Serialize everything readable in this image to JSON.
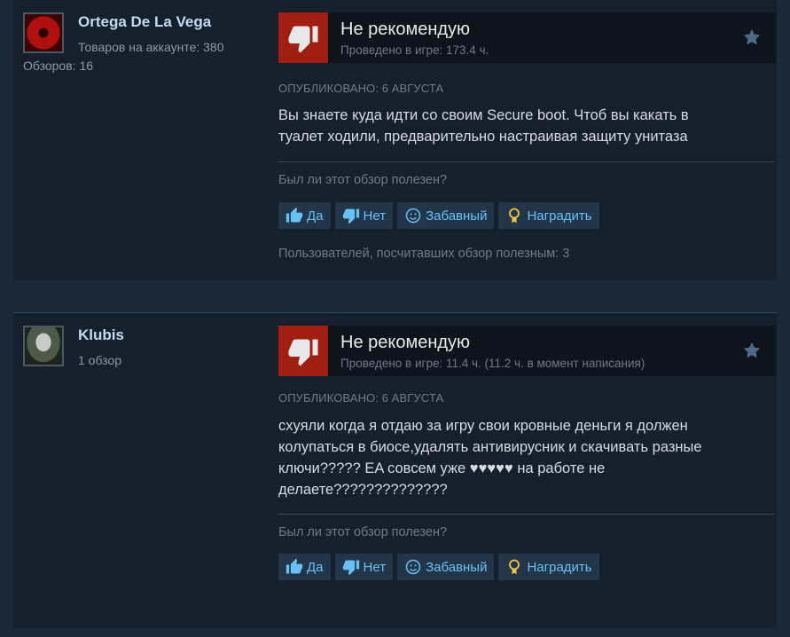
{
  "colors": {
    "background": "#1b2838",
    "card": "#16202d",
    "not_recommended": "#a01e12",
    "link": "#67c1f5",
    "username": "#c1dbf4"
  },
  "reviews": [
    {
      "user": {
        "name": "Ortega De La Vega",
        "products": "Товаров на аккаунте: 380",
        "reviews": "Обзоров: 16"
      },
      "verdict": "Не рекомендую",
      "playtime": "Проведено в игре: 173.4 ч.",
      "posted": "ОПУБЛИКОВАНО: 6 АВГУСТА",
      "text_lines": [
        "Вы знаете куда идти со своим Secure boot. Чтоб вы какать в",
        "туалет ходили, предварительно настраивая защиту унитаза"
      ],
      "helpful_question": "Был ли этот обзор полезен?",
      "buttons": {
        "yes": "Да",
        "no": "Нет",
        "funny": "Забавный",
        "award": "Наградить"
      },
      "helpful_count": "Пользователей, посчитавших обзор полезным: 3"
    },
    {
      "user": {
        "name": "Klubis",
        "reviews": "1 обзор"
      },
      "verdict": "Не рекомендую",
      "playtime": "Проведено в игре: 11.4 ч. (11.2 ч. в момент написания)",
      "posted": "ОПУБЛИКОВАНО: 6 АВГУСТА",
      "text_lines": [
        "схуяли когда я отдаю за игру свои кровные деньги я должен",
        "колупаться в биосе,удалять антивирусник и скачивать разные",
        "ключи????? EA совсем уже ♥♥♥♥♥ на работе не",
        "делаете??????????????"
      ],
      "helpful_question": "Был ли этот обзор полезен?",
      "buttons": {
        "yes": "Да",
        "no": "Нет",
        "funny": "Забавный",
        "award": "Наградить"
      }
    }
  ],
  "icons": {
    "thumb_down": "thumb-down-icon",
    "thumb_up": "thumb-up-icon",
    "smile": "smile-icon",
    "award": "award-icon",
    "star": "star-icon"
  }
}
